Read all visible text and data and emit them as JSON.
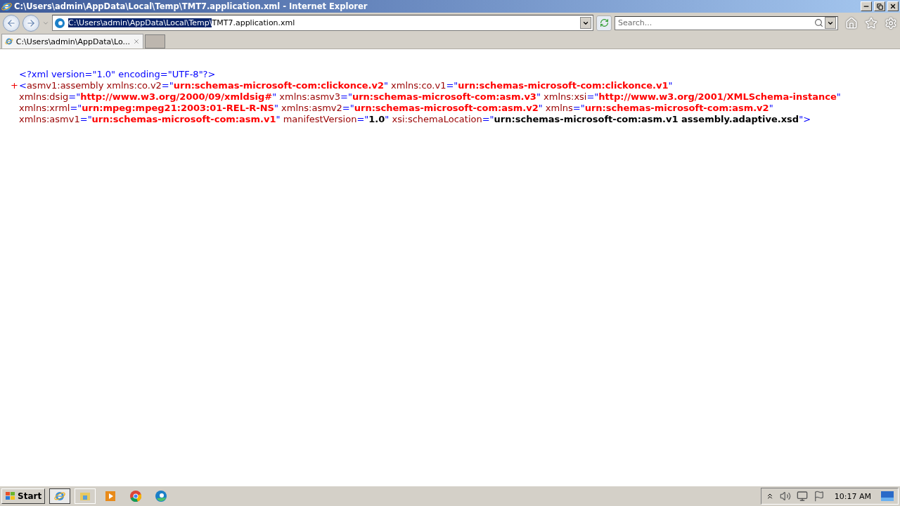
{
  "window": {
    "title": "C:\\Users\\admin\\AppData\\Local\\Temp\\TMT7.application.xml - Internet Explorer"
  },
  "address_bar": {
    "selected_text": "C:\\Users\\admin\\AppData\\Local\\Temp\\",
    "text": "TMT7.application.xml"
  },
  "search": {
    "placeholder": "Search..."
  },
  "tabs": [
    {
      "label": "C:\\Users\\admin\\AppData\\Lo...",
      "selected": true
    }
  ],
  "document": {
    "declaration": [
      {
        "kind": "punct",
        "text": "<?xml version=\"1.0\" encoding=\"UTF-8\"?>"
      }
    ],
    "element": {
      "toggle": "+",
      "tokens": [
        {
          "kind": "punct",
          "text": "<"
        },
        {
          "kind": "tag",
          "text": "asmv1:assembly"
        },
        {
          "kind": "attr",
          "text": " xmlns:co.v2"
        },
        {
          "kind": "punct",
          "text": "=\""
        },
        {
          "kind": "ns",
          "text": "urn:schemas-microsoft-com:clickonce.v2"
        },
        {
          "kind": "punct",
          "text": "\""
        },
        {
          "kind": "attr",
          "text": " xmlns:co.v1"
        },
        {
          "kind": "punct",
          "text": "=\""
        },
        {
          "kind": "ns",
          "text": "urn:schemas-microsoft-com:clickonce.v1"
        },
        {
          "kind": "punct",
          "text": "\""
        },
        {
          "kind": "attr",
          "text": " xmlns:dsig"
        },
        {
          "kind": "punct",
          "text": "=\""
        },
        {
          "kind": "ns",
          "text": "http://www.w3.org/2000/09/xmldsig#"
        },
        {
          "kind": "punct",
          "text": "\""
        },
        {
          "kind": "attr",
          "text": " xmlns:asmv3"
        },
        {
          "kind": "punct",
          "text": "=\""
        },
        {
          "kind": "ns",
          "text": "urn:schemas-microsoft-com:asm.v3"
        },
        {
          "kind": "punct",
          "text": "\""
        },
        {
          "kind": "attr",
          "text": " xmlns:xsi"
        },
        {
          "kind": "punct",
          "text": "=\""
        },
        {
          "kind": "ns",
          "text": "http://www.w3.org/2001/XMLSchema-instance"
        },
        {
          "kind": "punct",
          "text": "\""
        },
        {
          "kind": "attr",
          "text": " xmlns:xrml"
        },
        {
          "kind": "punct",
          "text": "=\""
        },
        {
          "kind": "ns",
          "text": "urn:mpeg:mpeg21:2003:01-REL-R-NS"
        },
        {
          "kind": "punct",
          "text": "\""
        },
        {
          "kind": "attr",
          "text": " xmlns:asmv2"
        },
        {
          "kind": "punct",
          "text": "=\""
        },
        {
          "kind": "ns",
          "text": "urn:schemas-microsoft-com:asm.v2"
        },
        {
          "kind": "punct",
          "text": "\""
        },
        {
          "kind": "attr",
          "text": " xmlns"
        },
        {
          "kind": "punct",
          "text": "=\""
        },
        {
          "kind": "ns",
          "text": "urn:schemas-microsoft-com:asm.v2"
        },
        {
          "kind": "punct",
          "text": "\""
        },
        {
          "kind": "attr",
          "text": " xmlns:asmv1"
        },
        {
          "kind": "punct",
          "text": "=\""
        },
        {
          "kind": "ns",
          "text": "urn:schemas-microsoft-com:asm.v1"
        },
        {
          "kind": "punct",
          "text": "\""
        },
        {
          "kind": "attr",
          "text": " manifestVersion"
        },
        {
          "kind": "punct",
          "text": "=\""
        },
        {
          "kind": "value",
          "text": "1.0"
        },
        {
          "kind": "punct",
          "text": "\""
        },
        {
          "kind": "attr",
          "text": " xsi:schemaLocation"
        },
        {
          "kind": "punct",
          "text": "=\""
        },
        {
          "kind": "value",
          "text": "urn:schemas-microsoft-com:asm.v1 assembly.adaptive.xsd"
        },
        {
          "kind": "punct",
          "text": "\">"
        }
      ]
    }
  },
  "taskbar": {
    "start": "Start",
    "clock": "10:17 AM"
  }
}
